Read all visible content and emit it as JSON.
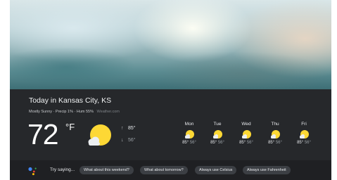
{
  "location_title": "Today in Kansas City, KS",
  "meta": {
    "text": "Mostly Sunny · Precip 1% · Hum 55%",
    "source": "Weather.com"
  },
  "current": {
    "temperature": "72",
    "unit": "°F",
    "condition_icon": "partly-sunny-icon",
    "high": "85°",
    "low": "56°"
  },
  "forecast": [
    {
      "day": "Mon",
      "high": "85°",
      "low": "56°",
      "icon": "partly-sunny-icon"
    },
    {
      "day": "Tue",
      "high": "85°",
      "low": "56°",
      "icon": "partly-sunny-icon"
    },
    {
      "day": "Wed",
      "high": "85°",
      "low": "56°",
      "icon": "partly-sunny-icon"
    },
    {
      "day": "Thu",
      "high": "85°",
      "low": "56°",
      "icon": "partly-sunny-icon"
    },
    {
      "day": "Fri",
      "high": "85°",
      "low": "56°",
      "icon": "partly-sunny-icon"
    }
  ],
  "footer": {
    "prompt": "Try saying...",
    "suggestions": [
      "What about this weekend?",
      "What about tomorrow?",
      "Always use Celsius",
      "Always use Fahrenheit"
    ]
  },
  "colors": {
    "sun": "#fdd835",
    "panel": "#26282b",
    "assistant_blue": "#4285f4",
    "assistant_red": "#ea4335",
    "assistant_yellow": "#fbbc05",
    "assistant_green": "#34a853"
  }
}
